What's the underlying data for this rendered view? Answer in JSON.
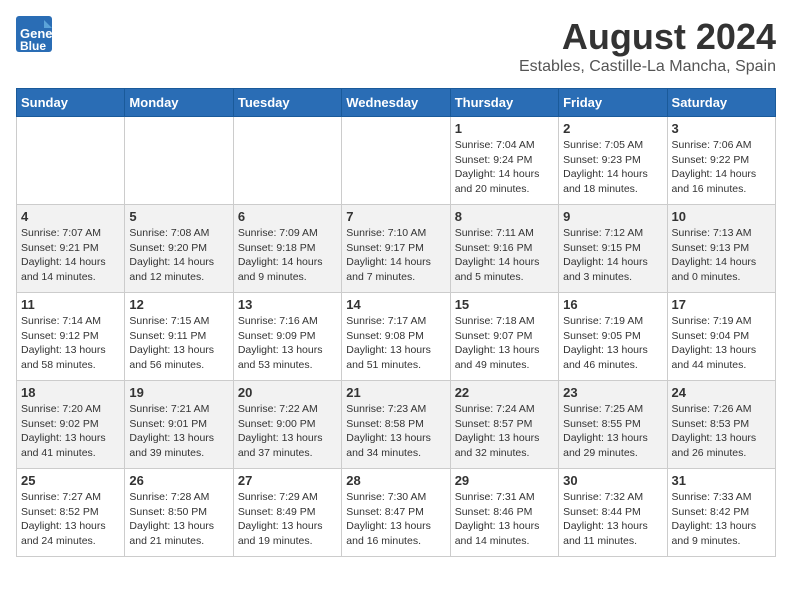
{
  "header": {
    "logo_general": "General",
    "logo_blue": "Blue",
    "main_title": "August 2024",
    "subtitle": "Estables, Castille-La Mancha, Spain"
  },
  "days_of_week": [
    "Sunday",
    "Monday",
    "Tuesday",
    "Wednesday",
    "Thursday",
    "Friday",
    "Saturday"
  ],
  "weeks": [
    [
      {
        "day": "",
        "content": ""
      },
      {
        "day": "",
        "content": ""
      },
      {
        "day": "",
        "content": ""
      },
      {
        "day": "",
        "content": ""
      },
      {
        "day": "1",
        "content": "Sunrise: 7:04 AM\nSunset: 9:24 PM\nDaylight: 14 hours\nand 20 minutes."
      },
      {
        "day": "2",
        "content": "Sunrise: 7:05 AM\nSunset: 9:23 PM\nDaylight: 14 hours\nand 18 minutes."
      },
      {
        "day": "3",
        "content": "Sunrise: 7:06 AM\nSunset: 9:22 PM\nDaylight: 14 hours\nand 16 minutes."
      }
    ],
    [
      {
        "day": "4",
        "content": "Sunrise: 7:07 AM\nSunset: 9:21 PM\nDaylight: 14 hours\nand 14 minutes."
      },
      {
        "day": "5",
        "content": "Sunrise: 7:08 AM\nSunset: 9:20 PM\nDaylight: 14 hours\nand 12 minutes."
      },
      {
        "day": "6",
        "content": "Sunrise: 7:09 AM\nSunset: 9:18 PM\nDaylight: 14 hours\nand 9 minutes."
      },
      {
        "day": "7",
        "content": "Sunrise: 7:10 AM\nSunset: 9:17 PM\nDaylight: 14 hours\nand 7 minutes."
      },
      {
        "day": "8",
        "content": "Sunrise: 7:11 AM\nSunset: 9:16 PM\nDaylight: 14 hours\nand 5 minutes."
      },
      {
        "day": "9",
        "content": "Sunrise: 7:12 AM\nSunset: 9:15 PM\nDaylight: 14 hours\nand 3 minutes."
      },
      {
        "day": "10",
        "content": "Sunrise: 7:13 AM\nSunset: 9:13 PM\nDaylight: 14 hours\nand 0 minutes."
      }
    ],
    [
      {
        "day": "11",
        "content": "Sunrise: 7:14 AM\nSunset: 9:12 PM\nDaylight: 13 hours\nand 58 minutes."
      },
      {
        "day": "12",
        "content": "Sunrise: 7:15 AM\nSunset: 9:11 PM\nDaylight: 13 hours\nand 56 minutes."
      },
      {
        "day": "13",
        "content": "Sunrise: 7:16 AM\nSunset: 9:09 PM\nDaylight: 13 hours\nand 53 minutes."
      },
      {
        "day": "14",
        "content": "Sunrise: 7:17 AM\nSunset: 9:08 PM\nDaylight: 13 hours\nand 51 minutes."
      },
      {
        "day": "15",
        "content": "Sunrise: 7:18 AM\nSunset: 9:07 PM\nDaylight: 13 hours\nand 49 minutes."
      },
      {
        "day": "16",
        "content": "Sunrise: 7:19 AM\nSunset: 9:05 PM\nDaylight: 13 hours\nand 46 minutes."
      },
      {
        "day": "17",
        "content": "Sunrise: 7:19 AM\nSunset: 9:04 PM\nDaylight: 13 hours\nand 44 minutes."
      }
    ],
    [
      {
        "day": "18",
        "content": "Sunrise: 7:20 AM\nSunset: 9:02 PM\nDaylight: 13 hours\nand 41 minutes."
      },
      {
        "day": "19",
        "content": "Sunrise: 7:21 AM\nSunset: 9:01 PM\nDaylight: 13 hours\nand 39 minutes."
      },
      {
        "day": "20",
        "content": "Sunrise: 7:22 AM\nSunset: 9:00 PM\nDaylight: 13 hours\nand 37 minutes."
      },
      {
        "day": "21",
        "content": "Sunrise: 7:23 AM\nSunset: 8:58 PM\nDaylight: 13 hours\nand 34 minutes."
      },
      {
        "day": "22",
        "content": "Sunrise: 7:24 AM\nSunset: 8:57 PM\nDaylight: 13 hours\nand 32 minutes."
      },
      {
        "day": "23",
        "content": "Sunrise: 7:25 AM\nSunset: 8:55 PM\nDaylight: 13 hours\nand 29 minutes."
      },
      {
        "day": "24",
        "content": "Sunrise: 7:26 AM\nSunset: 8:53 PM\nDaylight: 13 hours\nand 26 minutes."
      }
    ],
    [
      {
        "day": "25",
        "content": "Sunrise: 7:27 AM\nSunset: 8:52 PM\nDaylight: 13 hours\nand 24 minutes."
      },
      {
        "day": "26",
        "content": "Sunrise: 7:28 AM\nSunset: 8:50 PM\nDaylight: 13 hours\nand 21 minutes."
      },
      {
        "day": "27",
        "content": "Sunrise: 7:29 AM\nSunset: 8:49 PM\nDaylight: 13 hours\nand 19 minutes."
      },
      {
        "day": "28",
        "content": "Sunrise: 7:30 AM\nSunset: 8:47 PM\nDaylight: 13 hours\nand 16 minutes."
      },
      {
        "day": "29",
        "content": "Sunrise: 7:31 AM\nSunset: 8:46 PM\nDaylight: 13 hours\nand 14 minutes."
      },
      {
        "day": "30",
        "content": "Sunrise: 7:32 AM\nSunset: 8:44 PM\nDaylight: 13 hours\nand 11 minutes."
      },
      {
        "day": "31",
        "content": "Sunrise: 7:33 AM\nSunset: 8:42 PM\nDaylight: 13 hours\nand 9 minutes."
      }
    ]
  ]
}
